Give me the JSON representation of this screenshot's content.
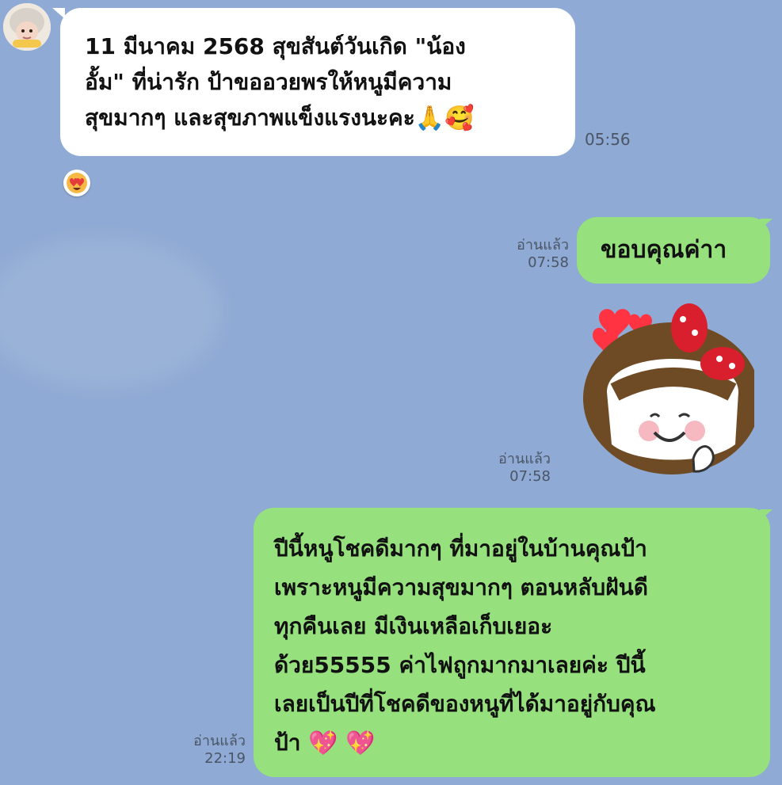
{
  "chat": {
    "incoming": {
      "lines": [
        "11 มีนาคม 2568 สุขสันต์วันเกิด \"น้อง",
        "อั้ม\" ที่น่ารัก  ป้าขออวยพรให้หนูมีความ",
        "สุขมากๆ และสุขภาพแข็งแรงนะคะ"
      ],
      "emoji_1": "🙏",
      "emoji_2": "🥰",
      "time": "05:56"
    },
    "reaction_emoji": "😍",
    "outgoing_1": {
      "text": "ขอบคุณค่าา",
      "read": "อ่านแล้ว",
      "time": "07:58"
    },
    "sticker": {
      "read": "อ่านแล้ว",
      "time": "07:58"
    },
    "outgoing_2": {
      "lines": [
        "ปีนี้หนูโชคดีมากๆ ที่มาอยู่ในบ้านคุณป้า",
        "เพราะหนูมีความสุขมากๆ ตอนหลับฝันดี",
        "ทุกคืนเลย มีเงินเหลือเก็บเยอะ",
        "ด้วย55555 ค่าไฟถูกมากมาเลยค่ะ ปีนี้",
        "เลยเป็นปีที่โชคดีของหนูที่ได้มาอยู่กับคุณ",
        "ป้า"
      ],
      "emoji_1": "💖",
      "emoji_2": "💖",
      "read": "อ่านแล้ว",
      "time": "22:19"
    }
  },
  "colors": {
    "background": "#8faad4",
    "incoming_bubble": "#ffffff",
    "outgoing_bubble": "#96e07e"
  },
  "icons": {
    "avatar": "baby-avatar",
    "reaction": "heart-eyes-reaction-icon",
    "sticker": "girl-with-hearts-sticker"
  }
}
